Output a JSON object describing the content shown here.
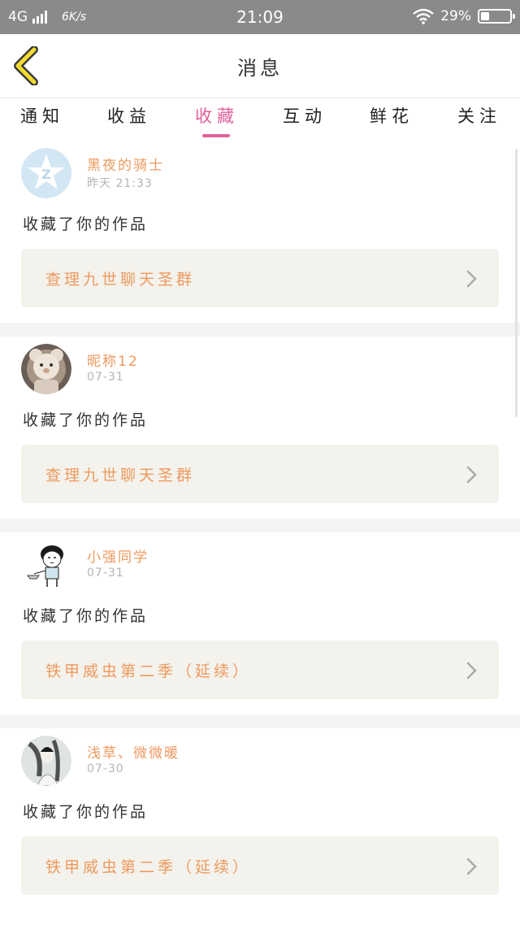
{
  "status_bar": {
    "network": "4G",
    "speed": "6K/s",
    "time": "21:09",
    "battery": "29%"
  },
  "header": {
    "title": "消息"
  },
  "tabs": [
    {
      "label": "通知"
    },
    {
      "label": "收益"
    },
    {
      "label": "收藏",
      "active": true
    },
    {
      "label": "互动"
    },
    {
      "label": "鲜花"
    },
    {
      "label": "关注"
    }
  ],
  "messages": [
    {
      "user": "黑夜的骑士",
      "time": "昨天 21:33",
      "action": "收藏了你的作品",
      "work": "查理九世聊天圣群",
      "avatar": "qq-default-avatar"
    },
    {
      "user": "昵称12",
      "time": "07-31",
      "action": "收藏了你的作品",
      "work": "查理九世聊天圣群",
      "avatar": "bear-doll-avatar"
    },
    {
      "user": "小强同学",
      "time": "07-31",
      "action": "收藏了你的作品",
      "work": "铁甲威虫第二季（延续）",
      "avatar": "cartoon-boy-avatar"
    },
    {
      "user": "浅草、微微暖",
      "time": "07-30",
      "action": "收藏了你的作品",
      "work": "铁甲威虫第二季（延续）",
      "avatar": "ink-painting-avatar"
    }
  ],
  "colors": {
    "accent": "#e2609a",
    "username": "#ee9a5e",
    "card_bg": "#f3f2ec",
    "back_arrow": "#f2dc2e"
  }
}
